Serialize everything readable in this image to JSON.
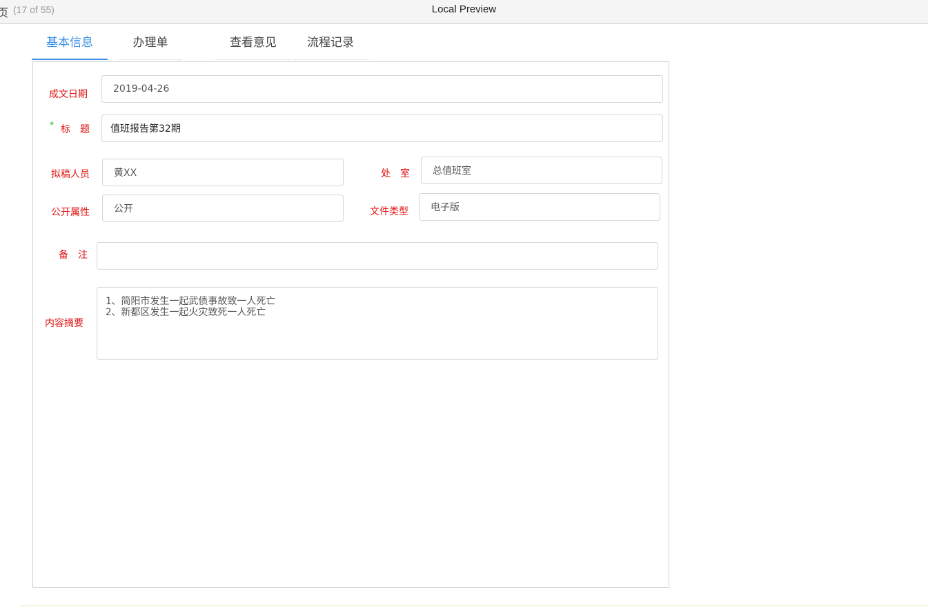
{
  "window": {
    "left_glyph": "页",
    "page_count": "(17 of 55)",
    "title": "Local Preview"
  },
  "tabs": [
    {
      "label": "基本信息",
      "active": true
    },
    {
      "label": "办理单",
      "active": false
    },
    {
      "label": "查看意见",
      "active": false
    },
    {
      "label": "流程记录",
      "active": false
    }
  ],
  "form": {
    "date": {
      "label": "成文日期",
      "value": "2019-04-26"
    },
    "title": {
      "required_mark": "*",
      "label": "标　题",
      "value": "值班报告第32期"
    },
    "drafter": {
      "label": "拟稿人员",
      "value": "黄XX"
    },
    "office": {
      "label": "处　室",
      "value": "总值班室"
    },
    "disclosure": {
      "label": "公开属性",
      "value": "公开"
    },
    "doc_type": {
      "label": "文件类型",
      "value": "电子版"
    },
    "remark": {
      "label": "备　注",
      "value": ""
    },
    "summary": {
      "label": "内容摘要",
      "value": "1、简阳市发生一起武债事故致一人死亡\n2、新都区发生一起火灾致死一人死亡"
    }
  },
  "colors": {
    "label": "#e01515",
    "active_tab": "#3a8ee6",
    "required_star": "#22aa22"
  }
}
